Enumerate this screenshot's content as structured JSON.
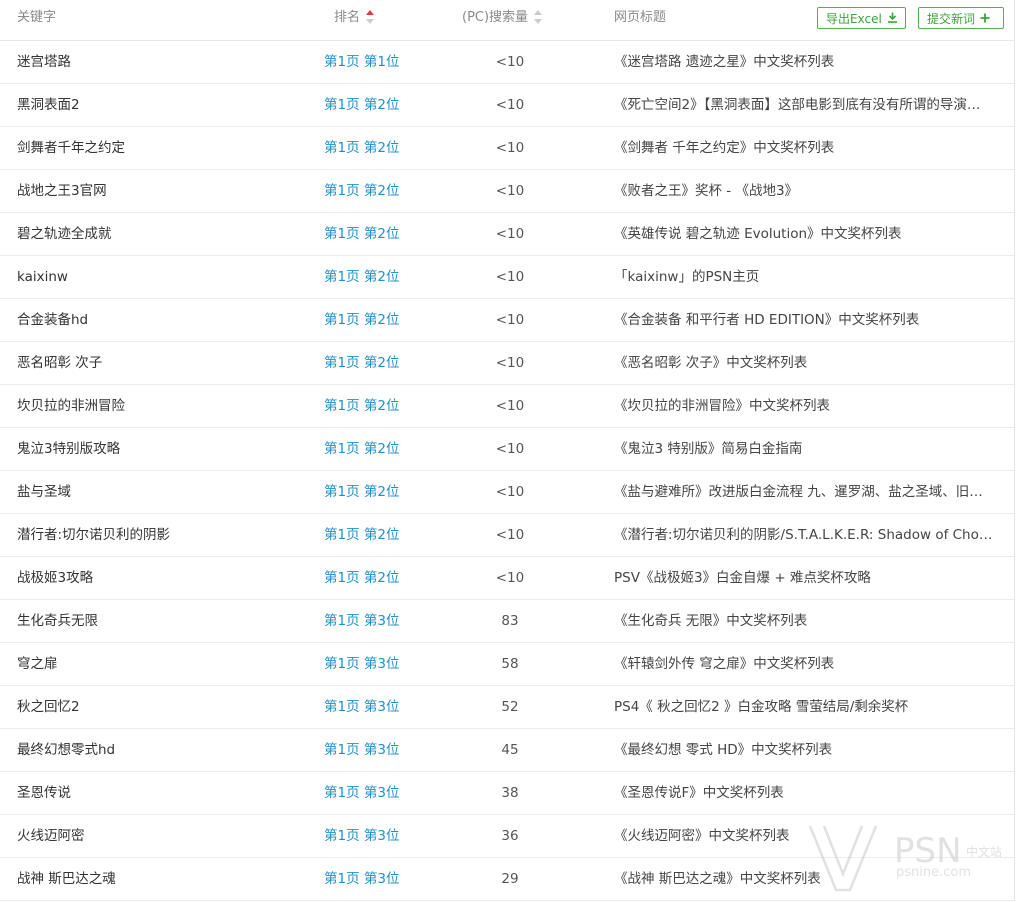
{
  "header": {
    "keyword": "关键字",
    "rank": "排名",
    "volume": "(PC)搜索量",
    "title": "网页标题",
    "export_label": "导出Excel",
    "submit_label": "提交新词"
  },
  "rows": [
    {
      "keyword": "迷宫塔路",
      "rank": "第1页 第1位",
      "volume": "<10",
      "title": "《迷宫塔路 遗迹之星》中文奖杯列表"
    },
    {
      "keyword": "黑洞表面2",
      "rank": "第1页 第2位",
      "volume": "<10",
      "title": "《死亡空间2》【黑洞表面】这部电影到底有没有所谓的导演…"
    },
    {
      "keyword": "剑舞者千年之约定",
      "rank": "第1页 第2位",
      "volume": "<10",
      "title": "《剑舞者 千年之约定》中文奖杯列表"
    },
    {
      "keyword": "战地之王3官网",
      "rank": "第1页 第2位",
      "volume": "<10",
      "title": "《败者之王》奖杯 - 《战地3》"
    },
    {
      "keyword": "碧之轨迹全成就",
      "rank": "第1页 第2位",
      "volume": "<10",
      "title": "《英雄传说 碧之轨迹 Evolution》中文奖杯列表"
    },
    {
      "keyword": "kaixinw",
      "rank": "第1页 第2位",
      "volume": "<10",
      "title": "「kaixinw」的PSN主页"
    },
    {
      "keyword": "合金装备hd",
      "rank": "第1页 第2位",
      "volume": "<10",
      "title": "《合金装备 和平行者 HD EDITION》中文奖杯列表"
    },
    {
      "keyword": "恶名昭彰 次子",
      "rank": "第1页 第2位",
      "volume": "<10",
      "title": "《恶名昭彰 次子》中文奖杯列表"
    },
    {
      "keyword": "坎贝拉的非洲冒险",
      "rank": "第1页 第2位",
      "volume": "<10",
      "title": "《坎贝拉的非洲冒险》中文奖杯列表"
    },
    {
      "keyword": "鬼泣3特别版攻略",
      "rank": "第1页 第2位",
      "volume": "<10",
      "title": "《鬼泣3 特别版》简易白金指南"
    },
    {
      "keyword": "盐与圣域",
      "rank": "第1页 第2位",
      "volume": "<10",
      "title": "《盐与避难所》改进版白金流程 九、暹罗湖、盐之圣域、旧…"
    },
    {
      "keyword": "潜行者:切尔诺贝利的阴影",
      "rank": "第1页 第2位",
      "volume": "<10",
      "title": "《潜行者:切尔诺贝利的阴影/S.T.A.L.K.E.R: Shadow of Cho…"
    },
    {
      "keyword": "战极姬3攻略",
      "rank": "第1页 第2位",
      "volume": "<10",
      "title": "PSV《战极姬3》白金自爆 + 难点奖杯攻略"
    },
    {
      "keyword": "生化奇兵无限",
      "rank": "第1页 第3位",
      "volume": "83",
      "title": "《生化奇兵 无限》中文奖杯列表"
    },
    {
      "keyword": "穹之扉",
      "rank": "第1页 第3位",
      "volume": "58",
      "title": "《轩辕剑外传 穹之扉》中文奖杯列表"
    },
    {
      "keyword": "秋之回忆2",
      "rank": "第1页 第3位",
      "volume": "52",
      "title": "PS4《 秋之回忆2 》白金攻略 雪萤结局/剩余奖杯"
    },
    {
      "keyword": "最终幻想零式hd",
      "rank": "第1页 第3位",
      "volume": "45",
      "title": "《最终幻想 零式 HD》中文奖杯列表"
    },
    {
      "keyword": "圣恩传说",
      "rank": "第1页 第3位",
      "volume": "38",
      "title": "《圣恩传说F》中文奖杯列表"
    },
    {
      "keyword": "火线迈阿密",
      "rank": "第1页 第3位",
      "volume": "36",
      "title": "《火线迈阿密》中文奖杯列表"
    },
    {
      "keyword": "战神 斯巴达之魂",
      "rank": "第1页 第3位",
      "volume": "29",
      "title": "《战神 斯巴达之魂》中文奖杯列表"
    }
  ],
  "watermark": {
    "brand": "PSN",
    "sub": "中文站",
    "url": "psnine.com"
  },
  "colors": {
    "rank_link": "#1e90c8",
    "button_green": "#3aa33a",
    "sort_active": "#e23b3b"
  }
}
